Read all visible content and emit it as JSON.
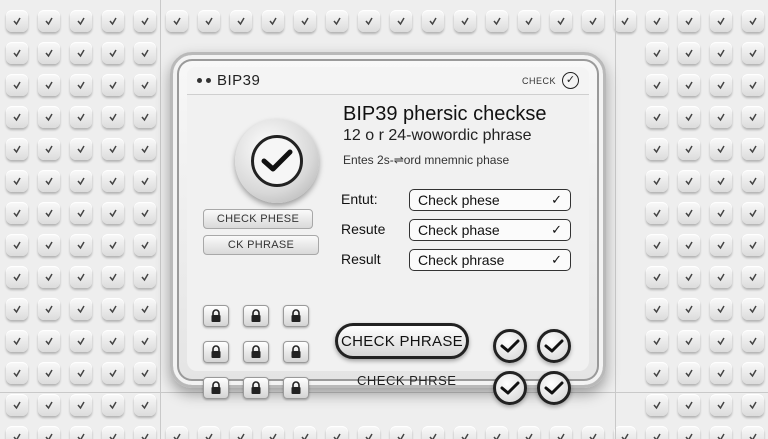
{
  "window": {
    "title": "BIP39",
    "titlebar_check_label": "CHECK",
    "icons": {
      "titlebar_check": "check-circle-icon",
      "big_check": "checkmark-icon"
    }
  },
  "header": {
    "heading": "BIP39 phersic checkse",
    "subheading": "12 o r 24-wowordic phrase",
    "hint": "Entes 2s-⇌ord mnemnic phase"
  },
  "side_buttons": {
    "check_phrase_1": "CHECK PHESE",
    "check_phrase_2": "CK PHRASE"
  },
  "rows": [
    {
      "label": "Entut:",
      "value": "Check phese",
      "check": "✓"
    },
    {
      "label": "Resute",
      "value": "Check phase",
      "check": "✓"
    },
    {
      "label": "Result",
      "value": "Check phrase",
      "check": "✓"
    }
  ],
  "actions": {
    "check_button": "CHECK PHRASE",
    "check_text": "CHECK PHRSE"
  },
  "locks_icon": "lock-icon",
  "colors": {
    "accent": "#222222",
    "panel": "#f1f1f1",
    "background": "#eeeeee"
  }
}
